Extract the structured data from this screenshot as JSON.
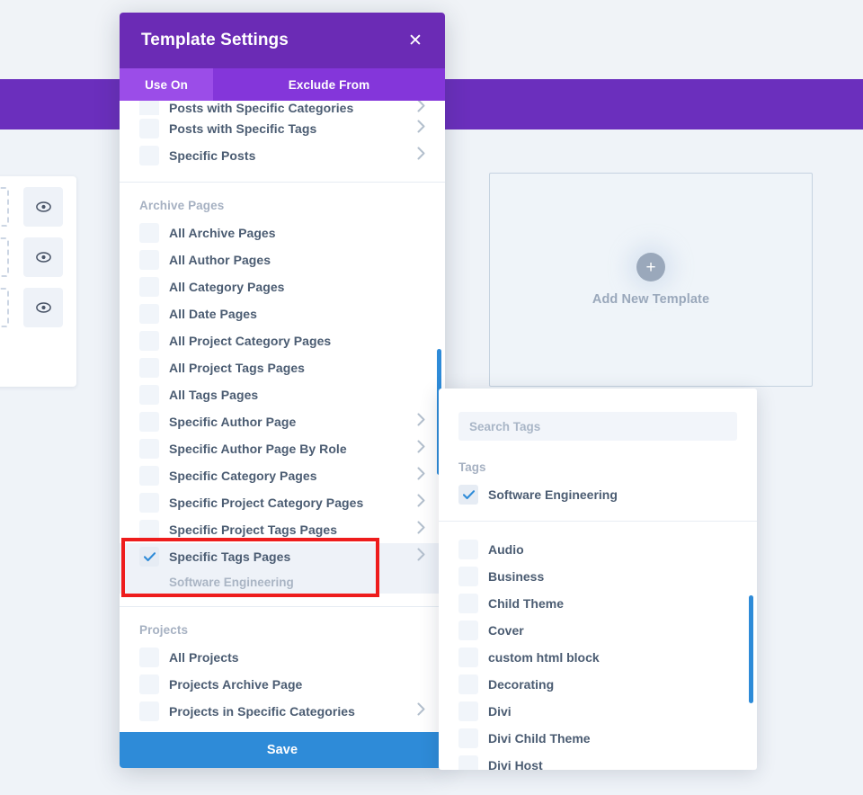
{
  "modal": {
    "title": "Template Settings",
    "close_icon": "close-icon",
    "tabs": [
      {
        "label": "Use On",
        "active": true
      },
      {
        "label": "Exclude From",
        "active": false
      }
    ],
    "save_label": "Save",
    "sections": [
      {
        "title": "",
        "options": [
          {
            "label": "Posts with Specific Categories",
            "checked": false,
            "chevron": true,
            "partial": true
          },
          {
            "label": "Posts with Specific Tags",
            "checked": false,
            "chevron": true
          },
          {
            "label": "Specific Posts",
            "checked": false,
            "chevron": true
          }
        ]
      },
      {
        "title": "Archive Pages",
        "options": [
          {
            "label": "All Archive Pages",
            "checked": false,
            "chevron": false
          },
          {
            "label": "All Author Pages",
            "checked": false,
            "chevron": false
          },
          {
            "label": "All Category Pages",
            "checked": false,
            "chevron": false
          },
          {
            "label": "All Date Pages",
            "checked": false,
            "chevron": false
          },
          {
            "label": "All Project Category Pages",
            "checked": false,
            "chevron": false
          },
          {
            "label": "All Project Tags Pages",
            "checked": false,
            "chevron": false
          },
          {
            "label": "All Tags Pages",
            "checked": false,
            "chevron": false
          },
          {
            "label": "Specific Author Page",
            "checked": false,
            "chevron": true
          },
          {
            "label": "Specific Author Page By Role",
            "checked": false,
            "chevron": true
          },
          {
            "label": "Specific Category Pages",
            "checked": false,
            "chevron": true
          },
          {
            "label": "Specific Project Category Pages",
            "checked": false,
            "chevron": true
          },
          {
            "label": "Specific Project Tags Pages",
            "checked": false,
            "chevron": true
          },
          {
            "label": "Specific Tags Pages",
            "checked": true,
            "chevron": true,
            "selected": true,
            "sublabel": "Software Engineering"
          }
        ]
      },
      {
        "title": "Projects",
        "options": [
          {
            "label": "All Projects",
            "checked": false,
            "chevron": false
          },
          {
            "label": "Projects Archive Page",
            "checked": false,
            "chevron": false
          },
          {
            "label": "Projects in Specific Categories",
            "checked": false,
            "chevron": true
          }
        ]
      }
    ]
  },
  "tags_panel": {
    "search_placeholder": "Search Tags",
    "search_value": "",
    "heading": "Tags",
    "selected_tags": [
      {
        "label": "Software Engineering",
        "checked": true
      }
    ],
    "all_tags": [
      {
        "label": "Audio",
        "checked": false
      },
      {
        "label": "Business",
        "checked": false
      },
      {
        "label": "Child Theme",
        "checked": false
      },
      {
        "label": "Cover",
        "checked": false
      },
      {
        "label": "custom html block",
        "checked": false
      },
      {
        "label": "Decorating",
        "checked": false
      },
      {
        "label": "Divi",
        "checked": false
      },
      {
        "label": "Divi Child Theme",
        "checked": false
      },
      {
        "label": "Divi Host",
        "checked": false
      }
    ]
  },
  "background": {
    "add_template_label": "Add New Template",
    "plus_icon": "plus-icon",
    "eye_rows": [
      {
        "icon": "eye-icon"
      },
      {
        "icon": "eye-icon"
      },
      {
        "icon": "eye-icon"
      }
    ]
  },
  "colors": {
    "header_purple": "#6b2bb5",
    "tab_active_purple": "#9b4de8",
    "tab_inactive_purple": "#8436da",
    "bg_bar_purple": "#6b2fbd",
    "save_blue": "#2e8bd8",
    "scrollbar_blue": "#2e8bd8",
    "highlight_red": "#ee1c1c",
    "text_slate": "#4b5c72",
    "muted_gray": "#a6b1c2"
  }
}
